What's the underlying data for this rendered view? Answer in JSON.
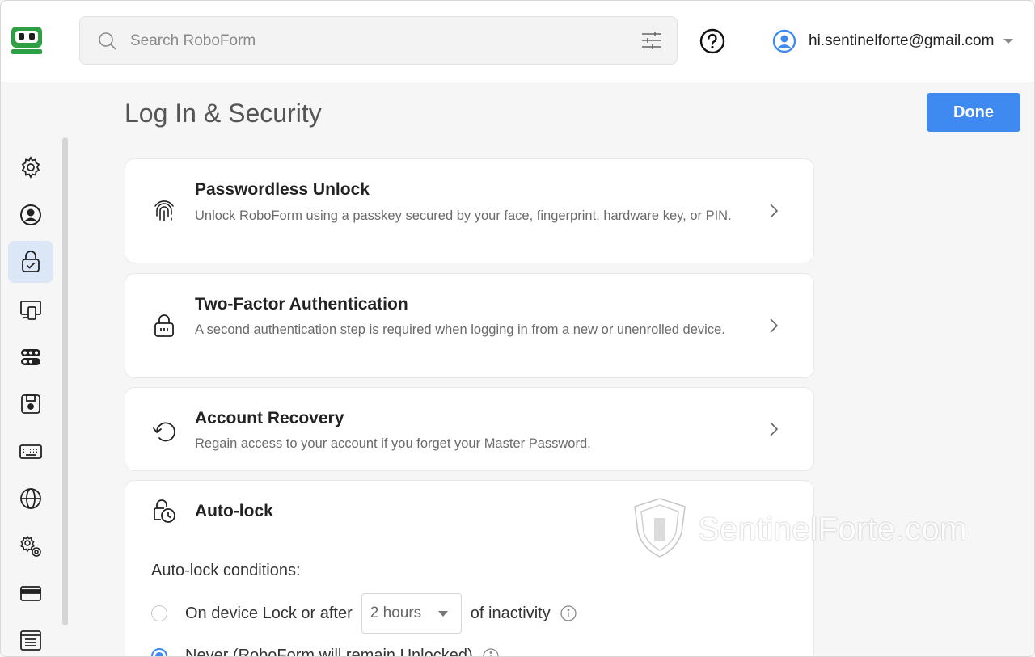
{
  "search": {
    "placeholder": "Search RoboForm"
  },
  "account": {
    "email": "hi.sentinelforte@gmail.com"
  },
  "page": {
    "title": "Log In & Security",
    "done_label": "Done"
  },
  "sidebar": {
    "items": [
      {
        "icon": "gear-icon"
      },
      {
        "icon": "user-circle-icon"
      },
      {
        "icon": "lock-check-icon",
        "active": true
      },
      {
        "icon": "devices-icon"
      },
      {
        "icon": "toggles-icon"
      },
      {
        "icon": "save-icon"
      },
      {
        "icon": "keyboard-icon"
      },
      {
        "icon": "globe-icon"
      },
      {
        "icon": "gears-icon"
      },
      {
        "icon": "credit-card-icon"
      },
      {
        "icon": "window-list-icon"
      }
    ]
  },
  "cards": {
    "passwordless": {
      "title": "Passwordless Unlock",
      "desc": "Unlock RoboForm using a passkey secured by your face, fingerprint, hardware key, or PIN."
    },
    "twofactor": {
      "title": "Two-Factor Authentication",
      "desc": "A second authentication step is required when logging in from a new or unenrolled device."
    },
    "recovery": {
      "title": "Account Recovery",
      "desc": "Regain access to your account if you forget your Master Password."
    },
    "autolock": {
      "title": "Auto-lock",
      "conditions_label": "Auto-lock conditions:",
      "option1_prefix": "On device Lock or after",
      "option1_select": "2 hours",
      "option1_suffix": "of inactivity",
      "option2_label": "Never (RoboForm will remain Unlocked)",
      "selected": "never"
    }
  },
  "watermark": {
    "text": "SentinelForte.com"
  },
  "colors": {
    "accent": "#3e8af0",
    "logo_green": "#2ea043"
  }
}
